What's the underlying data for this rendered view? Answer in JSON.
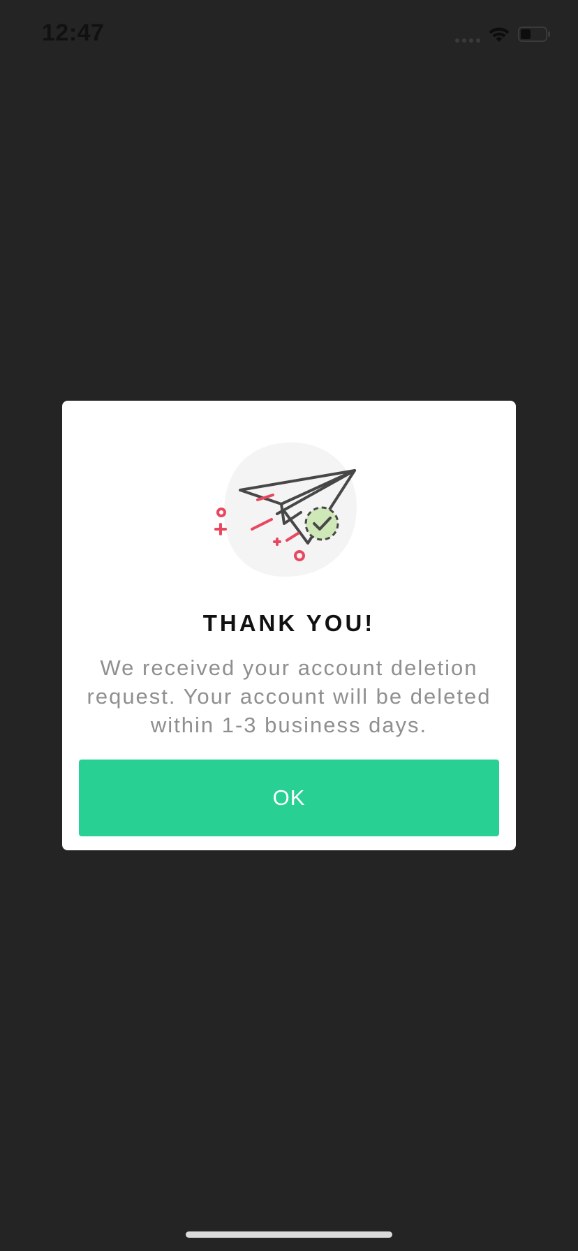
{
  "status_bar": {
    "time": "12:47"
  },
  "dialog": {
    "illustration_icon": "paper-plane-sent-icon",
    "title": "THANK YOU!",
    "message": "We received your account deletion request. Your account will be deleted within 1-3 business days.",
    "ok_label": "OK"
  },
  "colors": {
    "background": "#242424",
    "dialog": "#ffffff",
    "accent": "#29d093",
    "message_text": "#8f8f8f",
    "illustration_accent": "#e8485f",
    "check_fill": "#cfe8b8"
  }
}
